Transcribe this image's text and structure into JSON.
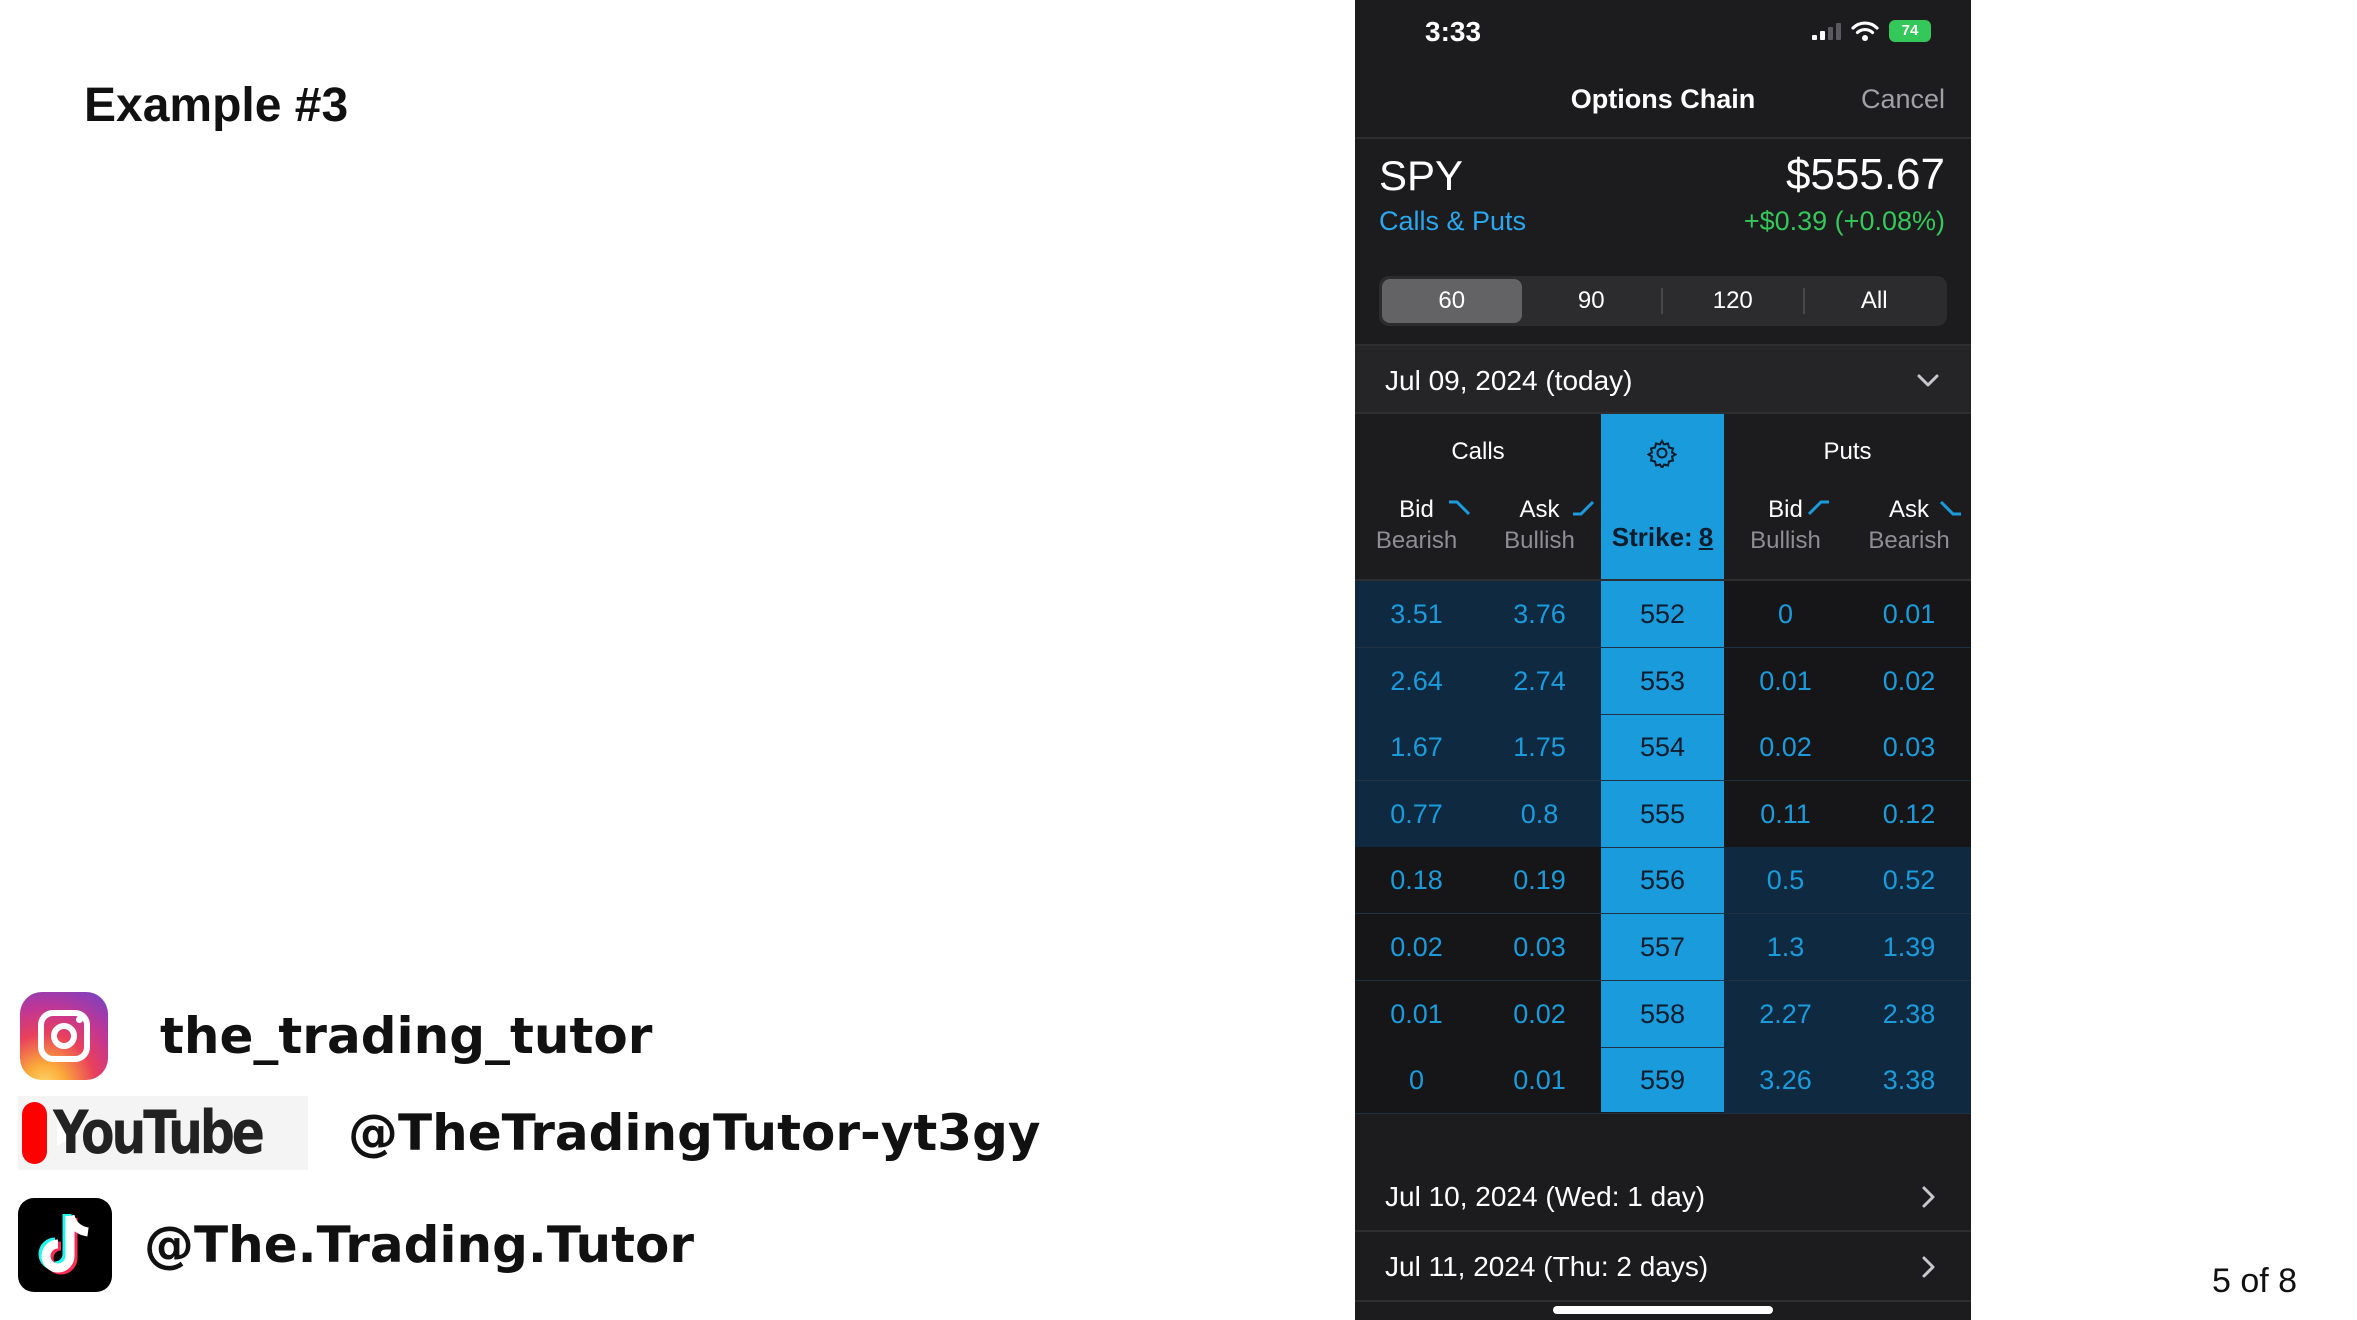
{
  "slide": {
    "title": "Example #3",
    "page_indicator": "5 of 8",
    "socials": {
      "instagram": {
        "icon": "instagram-icon",
        "handle": "the_trading_tutor"
      },
      "youtube": {
        "icon": "youtube-logo",
        "logo_text": "YouTube",
        "handle": "@TheTradingTutor-yt3gy"
      },
      "tiktok": {
        "icon": "tiktok-icon",
        "handle": "@The.Trading.Tutor"
      }
    }
  },
  "phone": {
    "status_bar": {
      "time": "3:33",
      "battery": "74"
    },
    "nav": {
      "title": "Options Chain",
      "cancel": "Cancel"
    },
    "quote": {
      "symbol": "SPY",
      "type": "Calls & Puts",
      "price": "$555.67",
      "change": "+$0.39 (+0.08%)"
    },
    "range_tabs": {
      "items": [
        "60",
        "90",
        "120",
        "All"
      ],
      "selected": "60"
    },
    "current_expiration": "Jul 09, 2024 (today)",
    "chain": {
      "calls_label": "Calls",
      "puts_label": "Puts",
      "headers": [
        {
          "label": "Bid",
          "sub": "Bearish"
        },
        {
          "label": "Ask",
          "sub": "Bullish"
        },
        {
          "label": "Bid",
          "sub": "Bullish"
        },
        {
          "label": "Ask",
          "sub": "Bearish"
        }
      ],
      "strike_label": "Strike:",
      "strike_count": "8",
      "rows": [
        {
          "call_bid": "3.51",
          "call_ask": "3.76",
          "strike": "552",
          "put_bid": "0",
          "put_ask": "0.01"
        },
        {
          "call_bid": "2.64",
          "call_ask": "2.74",
          "strike": "553",
          "put_bid": "0.01",
          "put_ask": "0.02"
        },
        {
          "call_bid": "1.67",
          "call_ask": "1.75",
          "strike": "554",
          "put_bid": "0.02",
          "put_ask": "0.03"
        },
        {
          "call_bid": "0.77",
          "call_ask": "0.8",
          "strike": "555",
          "put_bid": "0.11",
          "put_ask": "0.12"
        },
        {
          "call_bid": "0.18",
          "call_ask": "0.19",
          "strike": "556",
          "put_bid": "0.5",
          "put_ask": "0.52"
        },
        {
          "call_bid": "0.02",
          "call_ask": "0.03",
          "strike": "557",
          "put_bid": "1.3",
          "put_ask": "1.39"
        },
        {
          "call_bid": "0.01",
          "call_ask": "0.02",
          "strike": "558",
          "put_bid": "2.27",
          "put_ask": "2.38"
        },
        {
          "call_bid": "0",
          "call_ask": "0.01",
          "strike": "559",
          "put_bid": "3.26",
          "put_ask": "3.38"
        }
      ]
    },
    "other_expirations": [
      "Jul 10, 2024 (Wed: 1 day)",
      "Jul 11, 2024 (Thu: 2 days)"
    ],
    "colors": {
      "accent": "#1a9bdc",
      "itm_bg": "#0e2940",
      "positive": "#34c759",
      "background": "#1c1c1e"
    }
  }
}
